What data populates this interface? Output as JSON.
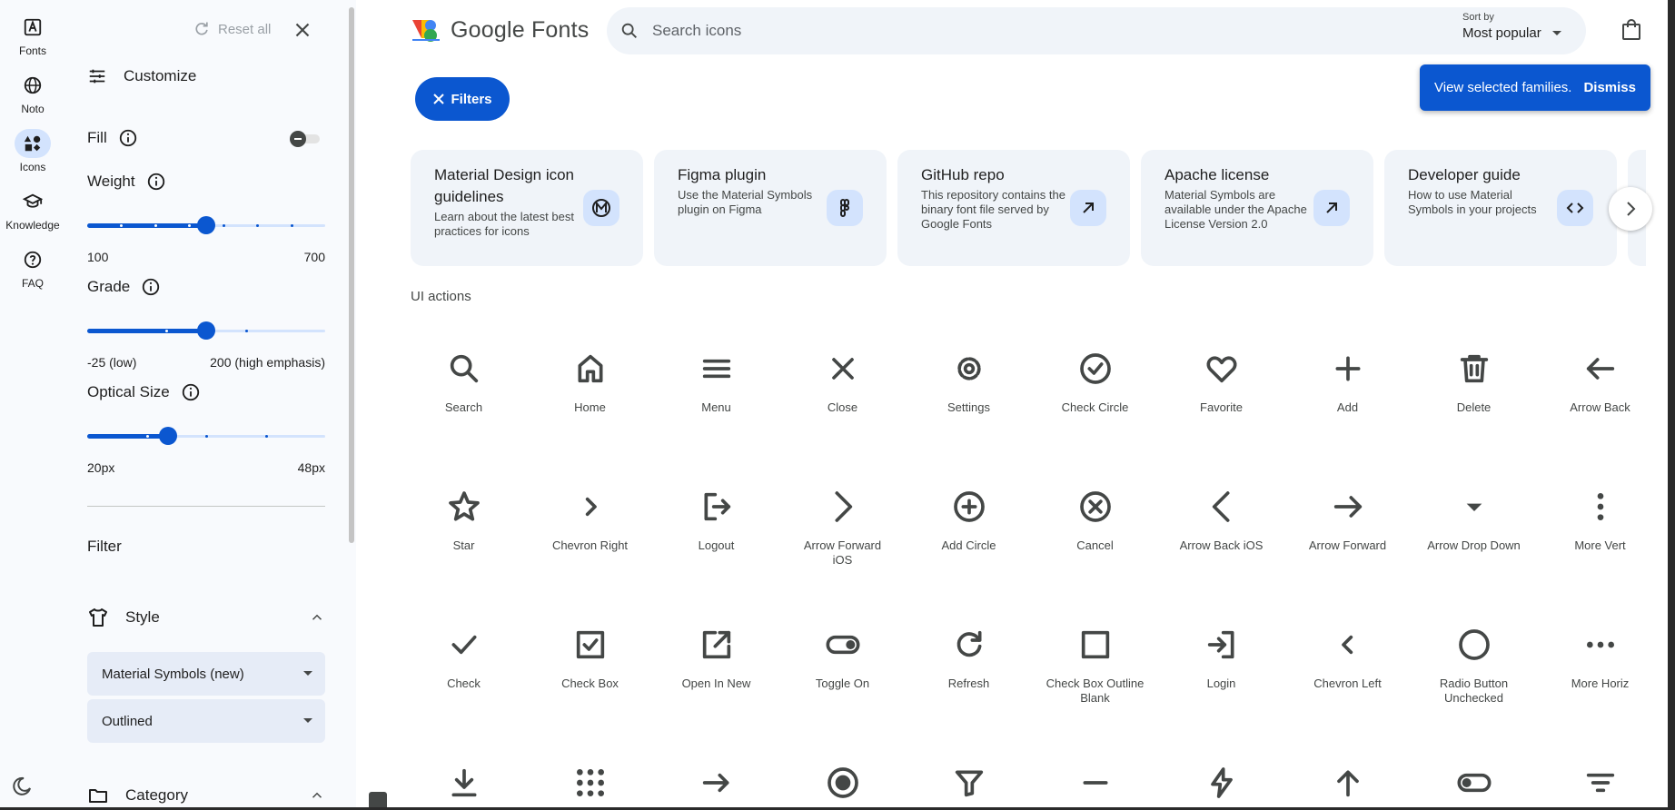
{
  "rail": {
    "items": [
      {
        "label": "Fonts",
        "icon": "fonts-icon"
      },
      {
        "label": "Noto",
        "icon": "globe-icon"
      },
      {
        "label": "Icons",
        "icon": "shapes-icon",
        "active": true
      },
      {
        "label": "Knowledge",
        "icon": "school-icon"
      },
      {
        "label": "FAQ",
        "icon": "help-icon"
      }
    ]
  },
  "panel": {
    "reset_label": "Reset all",
    "customize_label": "Customize",
    "fill_label": "Fill",
    "weight": {
      "label": "Weight",
      "min": "100",
      "max": "700",
      "value_fraction": 0.5
    },
    "grade": {
      "label": "Grade",
      "min": "-25 (low)",
      "max": "200 (high emphasis)",
      "value_fraction": 0.5
    },
    "optical_size": {
      "label": "Optical Size",
      "min": "20px",
      "max": "48px",
      "value_fraction": 0.34
    },
    "filter_label": "Filter",
    "style_label": "Style",
    "style_family": "Material Symbols (new)",
    "style_variant": "Outlined",
    "category_label": "Category"
  },
  "header": {
    "brand": "Google Fonts",
    "search_placeholder": "Search icons",
    "sort_label": "Sort by",
    "sort_value": "Most popular"
  },
  "filters_label": "Filters",
  "toast": {
    "message": "View selected families.",
    "dismiss": "Dismiss"
  },
  "cards": [
    {
      "title": "Material Design icon guidelines",
      "desc": "Learn about the latest best practices for icons",
      "icon": "material-logo-icon"
    },
    {
      "title": "Figma plugin",
      "desc": "Use the Material Symbols plugin on Figma",
      "icon": "figma-icon"
    },
    {
      "title": "GitHub repo",
      "desc": "This repository contains the binary font file served by Google Fonts",
      "icon": "arrow-outward-icon"
    },
    {
      "title": "Apache license",
      "desc": "Material Symbols are available under the Apache License Version 2.0",
      "icon": "arrow-outward-icon"
    },
    {
      "title": "Developer guide",
      "desc": "How to use Material Symbols in your projects",
      "icon": "code-icon"
    }
  ],
  "section_title": "UI actions",
  "icons": [
    {
      "name": "Search",
      "glyph": "search"
    },
    {
      "name": "Home",
      "glyph": "home"
    },
    {
      "name": "Menu",
      "glyph": "menu"
    },
    {
      "name": "Close",
      "glyph": "close"
    },
    {
      "name": "Settings",
      "glyph": "settings"
    },
    {
      "name": "Check Circle",
      "glyph": "check_circle"
    },
    {
      "name": "Favorite",
      "glyph": "favorite"
    },
    {
      "name": "Add",
      "glyph": "add"
    },
    {
      "name": "Delete",
      "glyph": "delete"
    },
    {
      "name": "Arrow Back",
      "glyph": "arrow_back"
    },
    {
      "name": "Star",
      "glyph": "star"
    },
    {
      "name": "Chevron Right",
      "glyph": "chevron_right"
    },
    {
      "name": "Logout",
      "glyph": "logout"
    },
    {
      "name": "Arrow Forward iOS",
      "glyph": "arrow_forward_ios"
    },
    {
      "name": "Add Circle",
      "glyph": "add_circle"
    },
    {
      "name": "Cancel",
      "glyph": "cancel"
    },
    {
      "name": "Arrow Back iOS",
      "glyph": "arrow_back_ios"
    },
    {
      "name": "Arrow Forward",
      "glyph": "arrow_forward"
    },
    {
      "name": "Arrow Drop Down",
      "glyph": "arrow_drop_down"
    },
    {
      "name": "More Vert",
      "glyph": "more_vert"
    },
    {
      "name": "Check",
      "glyph": "check"
    },
    {
      "name": "Check Box",
      "glyph": "check_box"
    },
    {
      "name": "Open In New",
      "glyph": "open_in_new"
    },
    {
      "name": "Toggle On",
      "glyph": "toggle_on"
    },
    {
      "name": "Refresh",
      "glyph": "refresh"
    },
    {
      "name": "Check Box Outline Blank",
      "glyph": "check_box_outline_blank"
    },
    {
      "name": "Login",
      "glyph": "login"
    },
    {
      "name": "Chevron Left",
      "glyph": "chevron_left"
    },
    {
      "name": "Radio Button Unchecked",
      "glyph": "radio_button_unchecked"
    },
    {
      "name": "More Horiz",
      "glyph": "more_horiz"
    },
    {
      "name": "",
      "glyph": "download"
    },
    {
      "name": "",
      "glyph": "apps"
    },
    {
      "name": "",
      "glyph": "east"
    },
    {
      "name": "",
      "glyph": "radio_button_checked"
    },
    {
      "name": "",
      "glyph": "filter_alt"
    },
    {
      "name": "",
      "glyph": "remove"
    },
    {
      "name": "",
      "glyph": "bolt"
    },
    {
      "name": "",
      "glyph": "arrow_upward"
    },
    {
      "name": "",
      "glyph": "toggle_off"
    },
    {
      "name": "",
      "glyph": "filter_list"
    }
  ],
  "colors": {
    "accent": "#0b57d0",
    "accent_light": "#d3e3fd",
    "icon": "#444746",
    "surface": "#f0f4f9",
    "panel": "#f8fafd"
  }
}
